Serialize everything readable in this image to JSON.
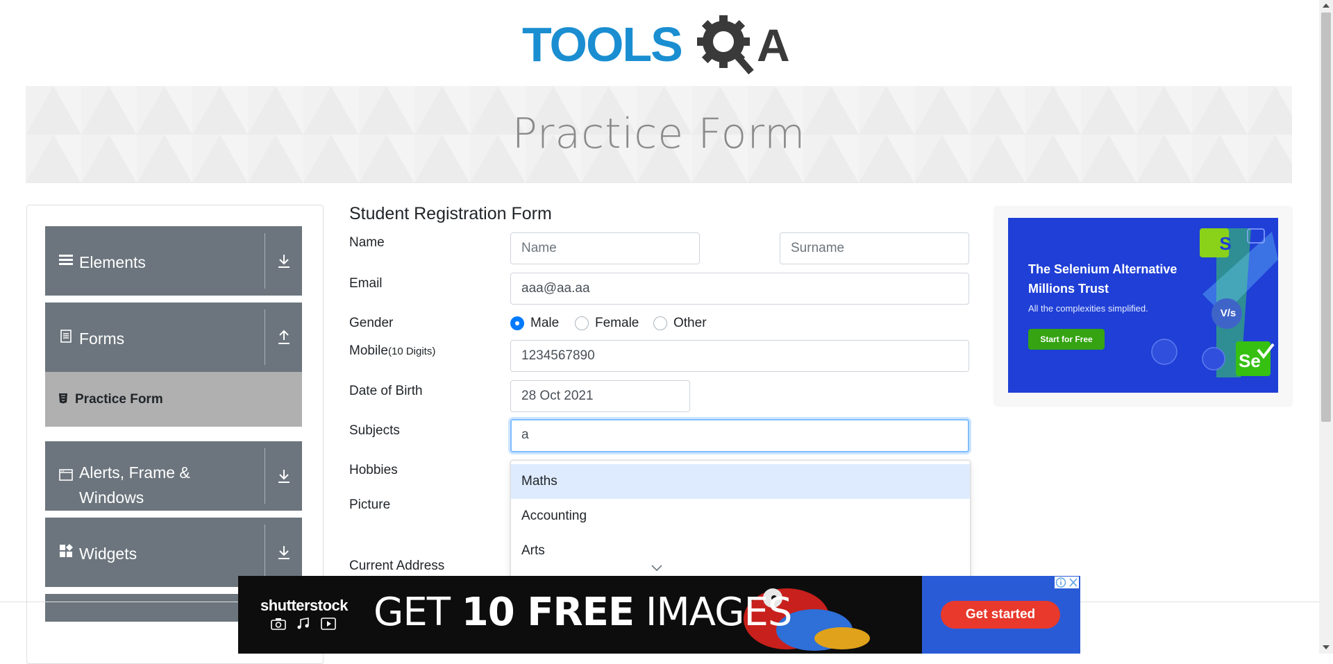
{
  "logo": {
    "text_tools": "TOOLS",
    "text_qa": "QA"
  },
  "banner": {
    "title": "Practice Form"
  },
  "sidebar": {
    "groups": [
      {
        "label": "Elements",
        "icon": "hamburger-icon",
        "arrow": "download-arrow-icon"
      },
      {
        "label": "Forms",
        "icon": "document-icon",
        "arrow": "upload-arrow-icon"
      },
      {
        "label_line1": "Alerts, Frame &",
        "label_line2": "Windows",
        "icon": "window-icon",
        "arrow": "download-arrow-icon"
      },
      {
        "label": "Widgets",
        "icon": "widgets-icon",
        "arrow": "download-arrow-icon"
      }
    ],
    "active_item": {
      "label": "Practice Form",
      "icon": "html5-icon"
    }
  },
  "form": {
    "title": "Student Registration Form",
    "labels": {
      "name": "Name",
      "email": "Email",
      "gender": "Gender",
      "mobile": "Mobile",
      "mobile_hint": "(10 Digits)",
      "dob": "Date of Birth",
      "subjects": "Subjects",
      "hobbies": "Hobbies",
      "picture": "Picture",
      "address": "Current Address"
    },
    "first_name_placeholder": "Name",
    "last_name_placeholder": "Surname",
    "email_value": "aaa@aa.aa",
    "gender_options": [
      "Male",
      "Female",
      "Other"
    ],
    "gender_selected": "Male",
    "mobile_value": "1234567890",
    "dob_value": "28 Oct 2021",
    "subjects_value": "a",
    "subjects_suggestions": [
      "Maths",
      "Accounting",
      "Arts"
    ],
    "highlighted_suggestion": "Maths"
  },
  "ad_right": {
    "title": "The Selenium Alternative Millions Trust",
    "subtitle": "All the complexities simplified.",
    "button": "Start for Free",
    "vs": "V/s",
    "logo_s": "S",
    "logo_se": "Se"
  },
  "ad_bottom": {
    "brand": "shutterstock",
    "headline_pre": "GET ",
    "headline_bold": "10 FREE",
    "headline_post": " IMAGES",
    "button": "Get started"
  },
  "colors": {
    "sidebar_group": "#6c757d",
    "active_item": "#b0b0b0",
    "accent": "#007bff",
    "highlight": "#deebff",
    "logo_blue": "#1a8ed1",
    "logo_dark": "#3a3a3a"
  }
}
